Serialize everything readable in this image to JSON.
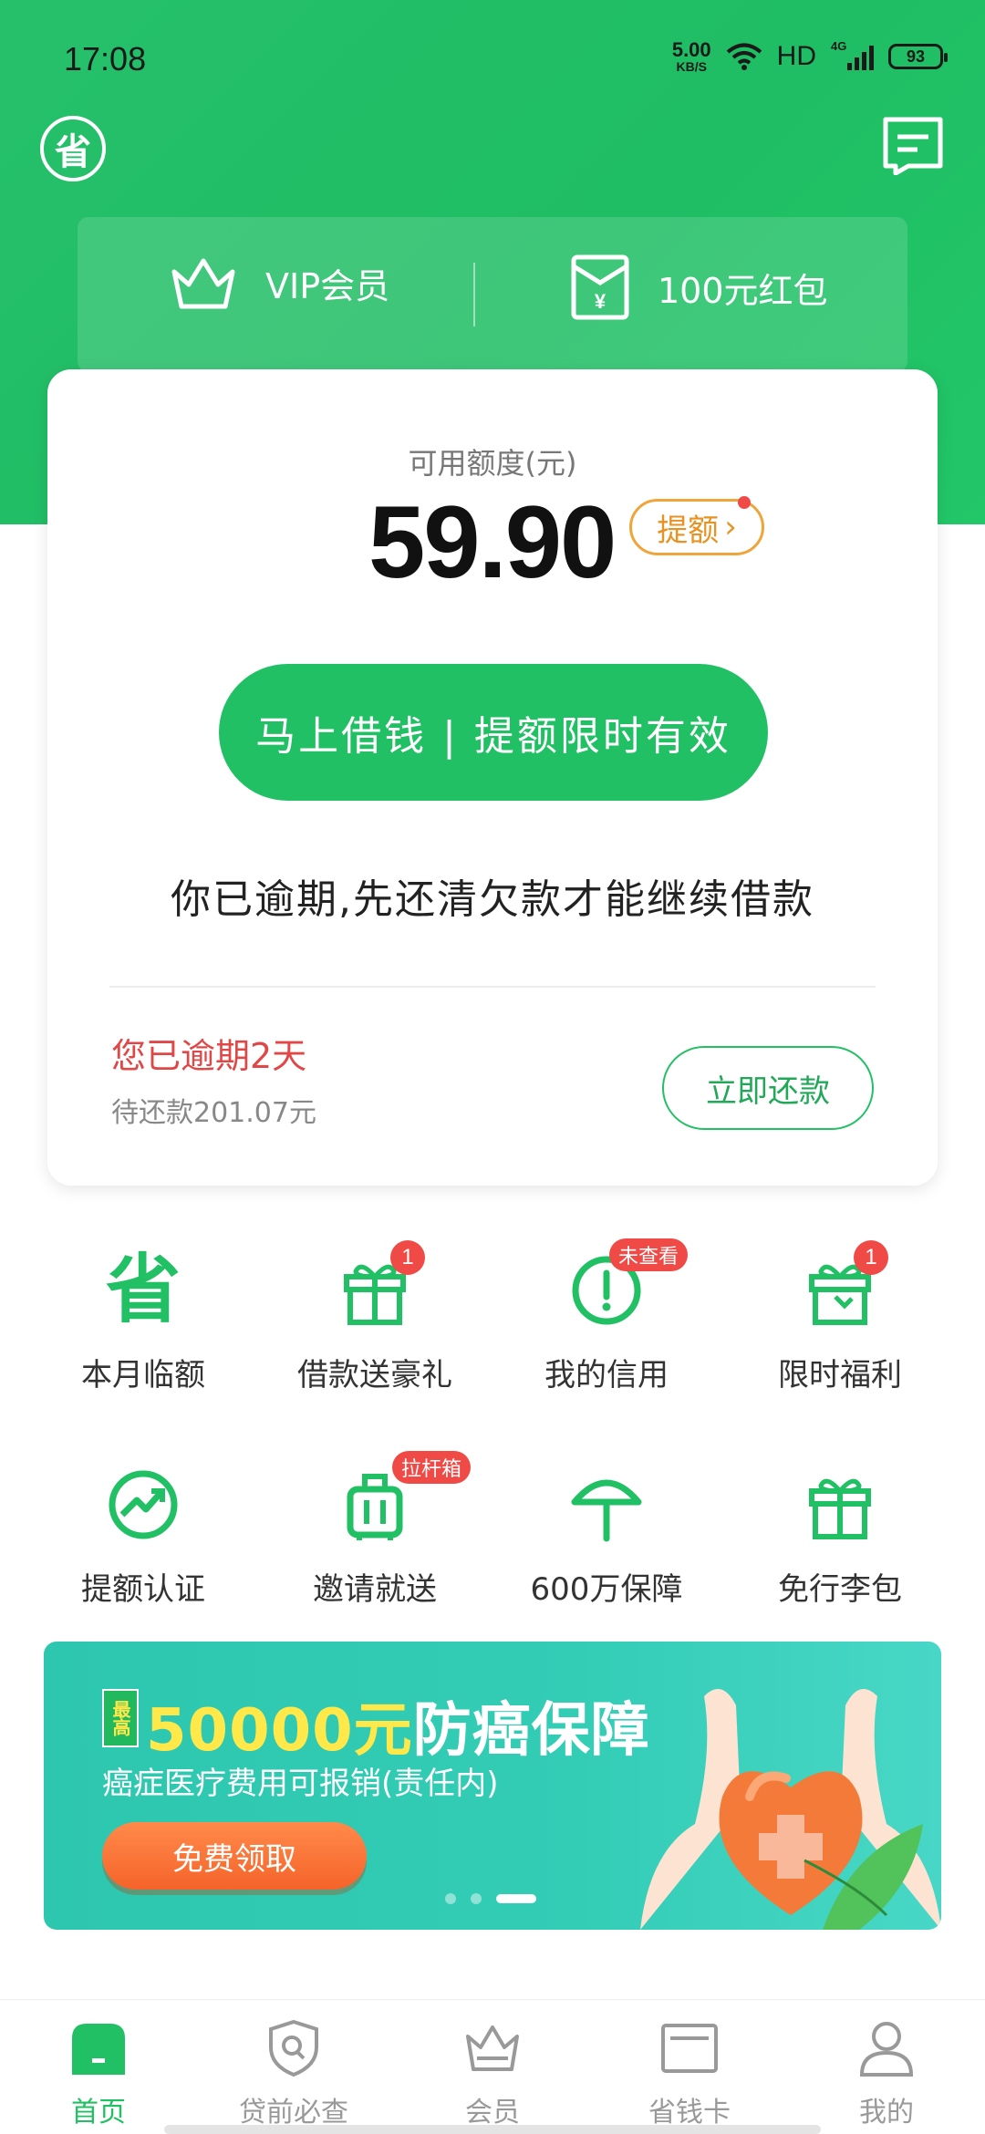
{
  "status_bar": {
    "time": "17:08",
    "net_speed_value": "5.00",
    "net_speed_unit": "KB/S",
    "hd": "HD",
    "network": "4G",
    "battery": "93"
  },
  "header": {
    "logo_char": "省",
    "vip_label": "VIP会员",
    "red_packet_label": "100元红包"
  },
  "card": {
    "quota_label": "可用额度(元)",
    "quota_amount": "59.90",
    "raise_label": "提额",
    "borrow_button": "马上借钱 | 提额限时有效",
    "overdue_notice": "你已逾期,先还清欠款才能继续借款",
    "overdue_days": "您已逾期2天",
    "pending_amount": "待还款201.07元",
    "repay_button": "立即还款"
  },
  "grid": {
    "items": [
      {
        "label": "本月临额",
        "badge": ""
      },
      {
        "label": "借款送豪礼",
        "badge": "1"
      },
      {
        "label": "我的信用",
        "badge": "未查看"
      },
      {
        "label": "限时福利",
        "badge": "1"
      },
      {
        "label": "提额认证",
        "badge": ""
      },
      {
        "label": "邀请就送",
        "badge": "拉杆箱"
      },
      {
        "label": "600万保障",
        "badge": ""
      },
      {
        "label": "免行李包",
        "badge": ""
      }
    ]
  },
  "banner": {
    "tag": "最高",
    "title_amount": "50000元",
    "title_rest": "防癌保障",
    "subtitle": "癌症医疗费用可报销(责任内)",
    "button": "免费领取",
    "active_slide": 3,
    "slide_count": 3
  },
  "bottom_nav": {
    "items": [
      {
        "label": "首页"
      },
      {
        "label": "贷前必查"
      },
      {
        "label": "会员"
      },
      {
        "label": "省钱卡"
      },
      {
        "label": "我的"
      }
    ],
    "active_index": 0
  },
  "colors": {
    "brand_green": "#22c064",
    "warning_orange": "#f0a53a",
    "alert_red": "#e04848"
  }
}
